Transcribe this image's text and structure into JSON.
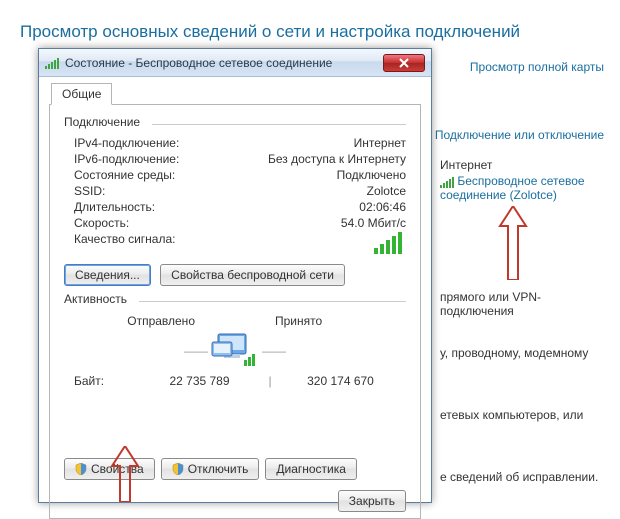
{
  "background": {
    "title": "Просмотр основных сведений о сети и настройка подключений",
    "link_full_map": "Просмотр полной карты",
    "link_conn_toggle": "Подключение или отключение",
    "internet_label": "Интернет",
    "wireless_link_line1": "Беспроводное сетевое",
    "wireless_link_line2": "соединение (Zolotce)",
    "frag_vpn": "прямого или VPN-подключения",
    "frag_wired": "у, проводному, модемному",
    "frag_computers": "етевых компьютеров, или",
    "frag_fix": "е сведений об исправлении."
  },
  "dialog": {
    "title": "Состояние - Беспроводное сетевое соединение",
    "tab_general": "Общие",
    "group_connection": "Подключение",
    "ipv4_label": "IPv4-подключение:",
    "ipv4_value": "Интернет",
    "ipv6_label": "IPv6-подключение:",
    "ipv6_value": "Без доступа к Интернету",
    "media_label": "Состояние среды:",
    "media_value": "Подключено",
    "ssid_label": "SSID:",
    "ssid_value": "Zolotce",
    "duration_label": "Длительность:",
    "duration_value": "02:06:46",
    "speed_label": "Скорость:",
    "speed_value": "54.0 Мбит/с",
    "signal_label": "Качество сигнала:",
    "btn_details": "Сведения...",
    "btn_wireless_props": "Свойства беспроводной сети",
    "group_activity": "Активность",
    "sent_label": "Отправлено",
    "received_label": "Принято",
    "bytes_label": "Байт:",
    "bytes_sent": "22 735 789",
    "bytes_received": "320 174 670",
    "btn_properties": "Свойства",
    "btn_disable": "Отключить",
    "btn_diagnose": "Диагностика",
    "btn_close": "Закрыть"
  }
}
